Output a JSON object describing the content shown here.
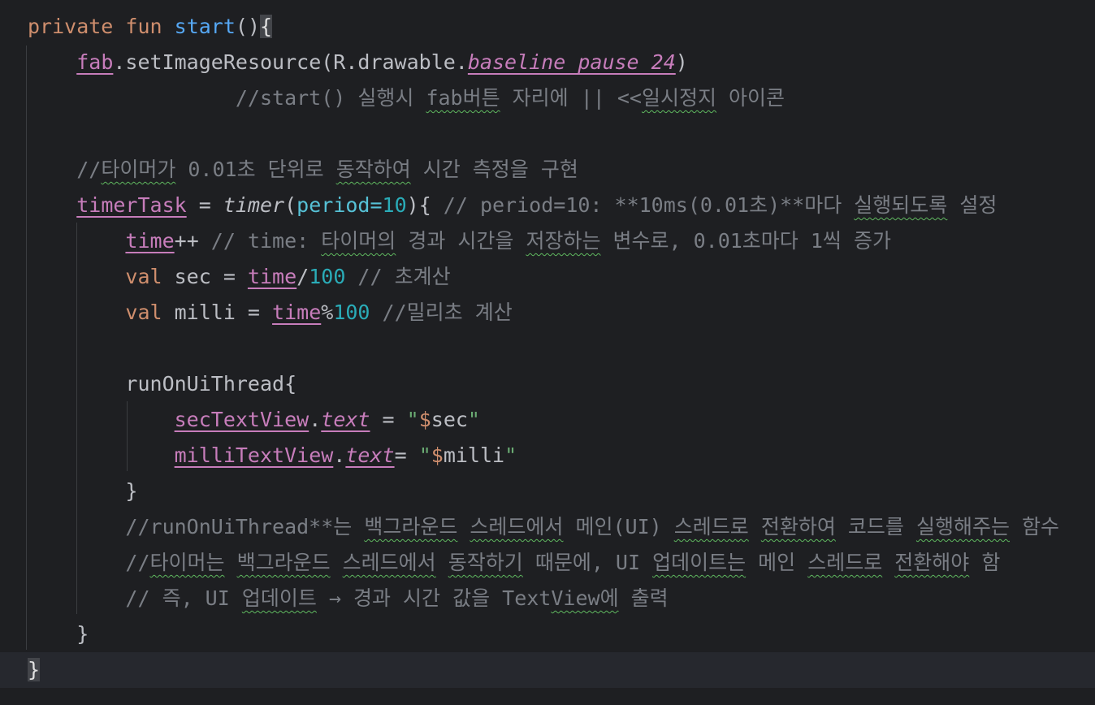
{
  "code_lines": [
    {
      "id": "L1",
      "tokens": [
        {
          "t": "private",
          "c": "kw"
        },
        {
          "t": " ",
          "c": "plain"
        },
        {
          "t": "fun",
          "c": "kw"
        },
        {
          "t": " ",
          "c": "plain"
        },
        {
          "t": "start",
          "c": "fn"
        },
        {
          "t": "()",
          "c": "plain"
        },
        {
          "t": "{",
          "c": "brace-hl"
        }
      ]
    },
    {
      "id": "L2",
      "tokens": [
        {
          "t": "    ",
          "c": "plain"
        },
        {
          "t": "fab",
          "c": "prop"
        },
        {
          "t": ".setImageResource(R.drawable.",
          "c": "plain"
        },
        {
          "t": "baseline_pause_24",
          "c": "prop-i"
        },
        {
          "t": ")",
          "c": "plain"
        }
      ]
    },
    {
      "id": "L3",
      "tokens": [
        {
          "t": "                 //start() 실행시 ",
          "c": "cmt"
        },
        {
          "t": "fab버튼",
          "c": "cmt typo"
        },
        {
          "t": " 자리에 || <<",
          "c": "cmt"
        },
        {
          "t": "일시정지",
          "c": "cmt typo"
        },
        {
          "t": " 아이콘",
          "c": "cmt"
        }
      ]
    },
    {
      "id": "L4",
      "tokens": []
    },
    {
      "id": "L5",
      "tokens": [
        {
          "t": "    //",
          "c": "cmt"
        },
        {
          "t": "타이머가",
          "c": "cmt typo"
        },
        {
          "t": " 0.01초 단위로 ",
          "c": "cmt"
        },
        {
          "t": "동작하여",
          "c": "cmt typo"
        },
        {
          "t": " 시간 측정을 구현",
          "c": "cmt"
        }
      ]
    },
    {
      "id": "L6",
      "tokens": [
        {
          "t": "    ",
          "c": "plain"
        },
        {
          "t": "timerTask",
          "c": "prop"
        },
        {
          "t": " = ",
          "c": "plain"
        },
        {
          "t": "timer",
          "c": "italic"
        },
        {
          "t": "(",
          "c": "plain"
        },
        {
          "t": "period=",
          "c": "param"
        },
        {
          "t": "10",
          "c": "num"
        },
        {
          "t": "){",
          "c": "plain"
        },
        {
          "t": " // period=10: **10ms(0.01초)**마다 ",
          "c": "cmt"
        },
        {
          "t": "실행되도록",
          "c": "cmt typo"
        },
        {
          "t": " 설정",
          "c": "cmt"
        }
      ]
    },
    {
      "id": "L7",
      "tokens": [
        {
          "t": "        ",
          "c": "plain"
        },
        {
          "t": "time",
          "c": "prop"
        },
        {
          "t": "++",
          "c": "plain"
        },
        {
          "t": " // time: ",
          "c": "cmt"
        },
        {
          "t": "타이머의",
          "c": "cmt typo"
        },
        {
          "t": " 경과 시간을 ",
          "c": "cmt"
        },
        {
          "t": "저장하는",
          "c": "cmt typo"
        },
        {
          "t": " 변수로, 0.01초마다 1씩 증가",
          "c": "cmt"
        }
      ]
    },
    {
      "id": "L8",
      "tokens": [
        {
          "t": "        ",
          "c": "plain"
        },
        {
          "t": "val",
          "c": "kw"
        },
        {
          "t": " sec = ",
          "c": "plain"
        },
        {
          "t": "time",
          "c": "prop"
        },
        {
          "t": "/",
          "c": "plain"
        },
        {
          "t": "100",
          "c": "num"
        },
        {
          "t": " // 초계산",
          "c": "cmt"
        }
      ]
    },
    {
      "id": "L9",
      "tokens": [
        {
          "t": "        ",
          "c": "plain"
        },
        {
          "t": "val",
          "c": "kw"
        },
        {
          "t": " milli = ",
          "c": "plain"
        },
        {
          "t": "time",
          "c": "prop"
        },
        {
          "t": "%",
          "c": "plain"
        },
        {
          "t": "100",
          "c": "num"
        },
        {
          "t": " //밀리초 계산",
          "c": "cmt"
        }
      ]
    },
    {
      "id": "L10",
      "tokens": []
    },
    {
      "id": "L11",
      "tokens": [
        {
          "t": "        runOnUiThread{",
          "c": "plain"
        }
      ]
    },
    {
      "id": "L12",
      "tokens": [
        {
          "t": "            ",
          "c": "plain"
        },
        {
          "t": "secTextView",
          "c": "prop"
        },
        {
          "t": ".",
          "c": "plain"
        },
        {
          "t": "text",
          "c": "prop-i"
        },
        {
          "t": " = ",
          "c": "plain"
        },
        {
          "t": "\"",
          "c": "str"
        },
        {
          "t": "$",
          "c": "tmpl"
        },
        {
          "t": "sec",
          "c": "plain"
        },
        {
          "t": "\"",
          "c": "str"
        }
      ]
    },
    {
      "id": "L13",
      "tokens": [
        {
          "t": "            ",
          "c": "plain"
        },
        {
          "t": "milliTextView",
          "c": "prop"
        },
        {
          "t": ".",
          "c": "plain"
        },
        {
          "t": "text",
          "c": "prop-i"
        },
        {
          "t": "= ",
          "c": "plain"
        },
        {
          "t": "\"",
          "c": "str"
        },
        {
          "t": "$",
          "c": "tmpl"
        },
        {
          "t": "milli",
          "c": "plain"
        },
        {
          "t": "\"",
          "c": "str"
        }
      ]
    },
    {
      "id": "L14",
      "tokens": [
        {
          "t": "        }",
          "c": "plain"
        }
      ]
    },
    {
      "id": "L15",
      "tokens": [
        {
          "t": "        //runOnUiThread**는 ",
          "c": "cmt"
        },
        {
          "t": "백그라운드",
          "c": "cmt typo"
        },
        {
          "t": " ",
          "c": "cmt"
        },
        {
          "t": "스레드에서",
          "c": "cmt typo"
        },
        {
          "t": " 메인(UI) ",
          "c": "cmt"
        },
        {
          "t": "스레드로",
          "c": "cmt typo"
        },
        {
          "t": " ",
          "c": "cmt"
        },
        {
          "t": "전환하여",
          "c": "cmt typo"
        },
        {
          "t": " 코드를 ",
          "c": "cmt"
        },
        {
          "t": "실행해주는",
          "c": "cmt typo"
        },
        {
          "t": " 함수",
          "c": "cmt"
        }
      ]
    },
    {
      "id": "L16",
      "tokens": [
        {
          "t": "        //",
          "c": "cmt"
        },
        {
          "t": "타이머는",
          "c": "cmt typo"
        },
        {
          "t": " ",
          "c": "cmt"
        },
        {
          "t": "백그라운드",
          "c": "cmt typo"
        },
        {
          "t": " ",
          "c": "cmt"
        },
        {
          "t": "스레드에서",
          "c": "cmt typo"
        },
        {
          "t": " ",
          "c": "cmt"
        },
        {
          "t": "동작하기",
          "c": "cmt typo"
        },
        {
          "t": " 때문에, UI ",
          "c": "cmt"
        },
        {
          "t": "업데이트는",
          "c": "cmt typo"
        },
        {
          "t": " 메인 ",
          "c": "cmt"
        },
        {
          "t": "스레드로",
          "c": "cmt typo"
        },
        {
          "t": " ",
          "c": "cmt"
        },
        {
          "t": "전환해야",
          "c": "cmt typo"
        },
        {
          "t": " 함",
          "c": "cmt"
        }
      ]
    },
    {
      "id": "L17",
      "tokens": [
        {
          "t": "        // 즉, UI ",
          "c": "cmt"
        },
        {
          "t": "업데이트",
          "c": "cmt typo"
        },
        {
          "t": " → 경과 시간 값을 Text",
          "c": "cmt"
        },
        {
          "t": "View에",
          "c": "cmt typo"
        },
        {
          "t": " 출력",
          "c": "cmt"
        }
      ]
    },
    {
      "id": "L18",
      "tokens": [
        {
          "t": "    }",
          "c": "plain"
        }
      ]
    },
    {
      "id": "L19",
      "tokens": [
        {
          "t": "}",
          "c": "brace-hl"
        }
      ]
    }
  ]
}
